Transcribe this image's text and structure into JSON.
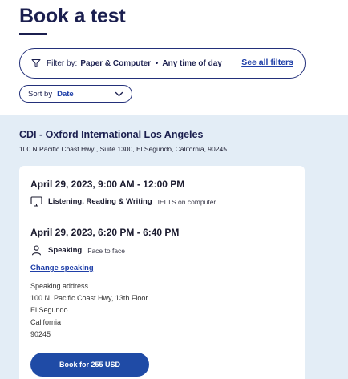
{
  "header": {
    "title": "Book a test"
  },
  "filter": {
    "label": "Filter by:",
    "value": "Paper & Computer  •  Any time of day",
    "see_all": "See all filters"
  },
  "sort": {
    "label": "Sort by",
    "value": "Date"
  },
  "centre": {
    "name": "CDI - Oxford International Los Angeles",
    "address": "100 N Pacific Coast Hwy , Suite 1300, El Segundo, California, 90245"
  },
  "card": {
    "written": {
      "datetime": "April 29, 2023, 9:00 AM - 12:00 PM",
      "name": "Listening, Reading & Writing",
      "mode": "IELTS on computer",
      "icon": "computer-icon"
    },
    "speaking": {
      "datetime": "April 29, 2023, 6:20 PM - 6:40 PM",
      "name": "Speaking",
      "mode": "Face to face",
      "icon": "person-icon",
      "change_label": "Change speaking",
      "address_title": "Speaking address",
      "address_lines": [
        "100 N. Pacific Coast Hwy, 13th Floor",
        "El Segundo",
        "California",
        "90245"
      ]
    },
    "book_label": "Book for 255 USD"
  },
  "colors": {
    "brand_navy": "#1b1f4f",
    "link_blue": "#1f3fa8",
    "button_blue": "#1f4ba6",
    "panel_bg": "#e3edf6"
  }
}
